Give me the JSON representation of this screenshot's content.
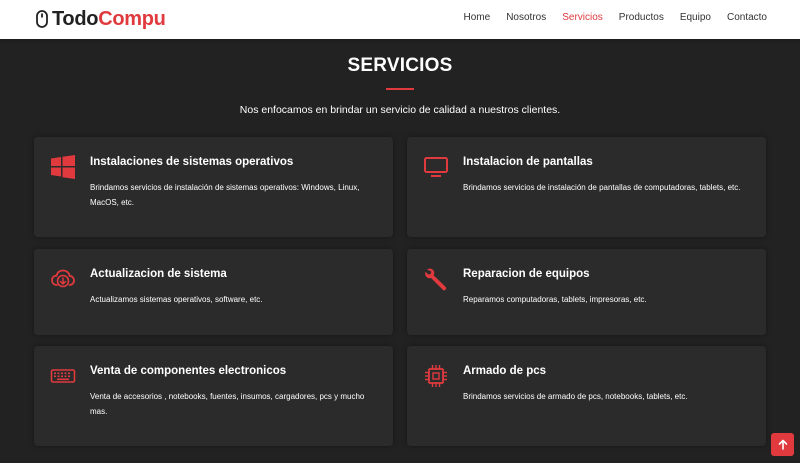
{
  "brand": {
    "part1": "Todo",
    "part2": "Compu",
    "accent_color": "#e03a3e",
    "icon": "mouse-icon"
  },
  "nav": {
    "items": [
      {
        "label": "Home"
      },
      {
        "label": "Nosotros"
      },
      {
        "label": "Servicios",
        "active": true
      },
      {
        "label": "Productos"
      },
      {
        "label": "Equipo"
      },
      {
        "label": "Contacto"
      }
    ]
  },
  "section": {
    "title": "SERVICIOS",
    "subtitle": "Nos enfocamos en brindar un servicio de calidad a nuestros clientes."
  },
  "services": [
    {
      "icon": "windows-icon",
      "title": "Instalaciones de sistemas operativos",
      "description": "Brindamos servicios de instalación de sistemas operativos: Windows, Linux, MacOS, etc."
    },
    {
      "icon": "monitor-icon",
      "title": "Instalacion de pantallas",
      "description": "Brindamos servicios de instalación de pantallas de computadoras, tablets, etc."
    },
    {
      "icon": "cloud-download-icon",
      "title": "Actualizacion de sistema",
      "description": "Actualizamos sistemas operativos, software, etc."
    },
    {
      "icon": "wrench-icon",
      "title": "Reparacion de equipos",
      "description": "Reparamos computadoras, tablets, impresoras, etc."
    },
    {
      "icon": "keyboard-icon",
      "title": "Venta de componentes electronicos",
      "description": "Venta de accesorios , notebooks, fuentes, insumos, cargadores, pcs y mucho mas."
    },
    {
      "icon": "cpu-icon",
      "title": "Armado de pcs",
      "description": "Brindamos servicios de armado de pcs, notebooks, tablets, etc."
    }
  ],
  "back_to_top": {
    "icon": "arrow-up-icon"
  }
}
